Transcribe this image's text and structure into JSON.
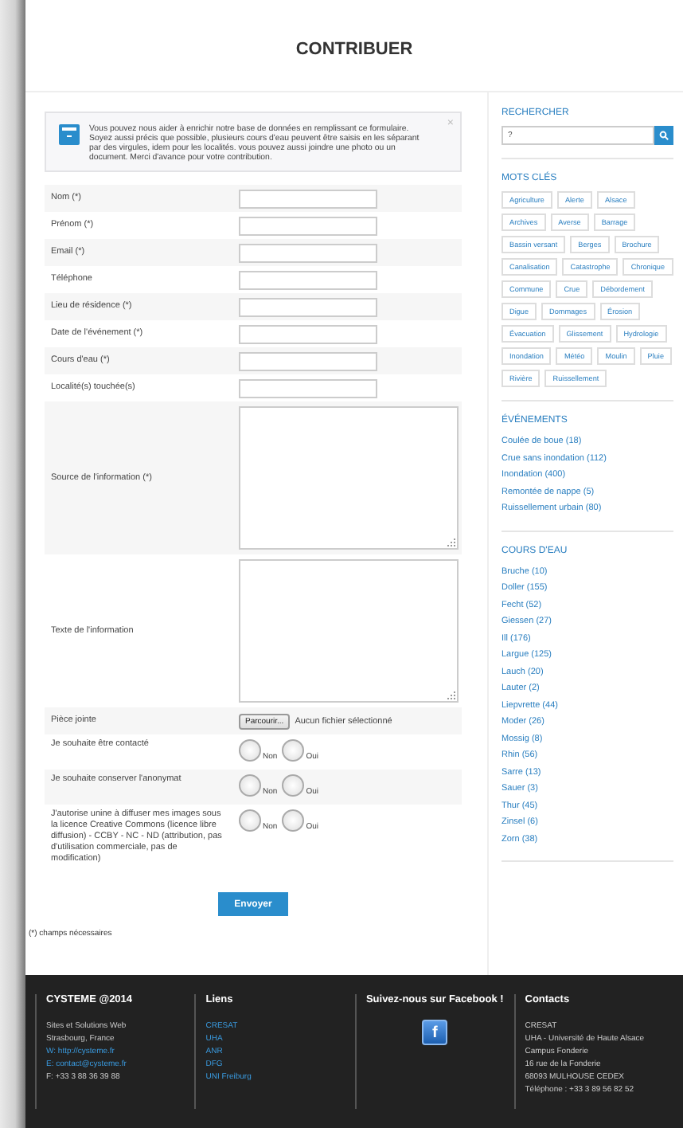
{
  "header": {
    "title": "CONTRIBUER"
  },
  "intro": {
    "text": "Vous pouvez nous aider à enrichir notre base de données en remplissant ce formulaire. Soyez aussi précis que possible, plusieurs cours d'eau peuvent être saisis en les séparant par des virgules, idem pour les localités. vous pouvez aussi joindre une photo ou un document. Merci d'avance pour votre contribution.",
    "close": "×"
  },
  "form": {
    "fields": [
      {
        "kind": "input",
        "label": "Nom (*)"
      },
      {
        "kind": "input",
        "label": "Prénom (*)"
      },
      {
        "kind": "input",
        "label": "Email (*)"
      },
      {
        "kind": "input",
        "label": "Téléphone"
      },
      {
        "kind": "input",
        "label": "Lieu de résidence (*)"
      },
      {
        "kind": "input",
        "label": "Date de l'événement (*)"
      },
      {
        "kind": "input",
        "label": "Cours d'eau (*)"
      },
      {
        "kind": "input",
        "label": "Localité(s) touchée(s)"
      },
      {
        "kind": "textarea",
        "label": "Source de l'information (*)"
      },
      {
        "kind": "textarea",
        "label": "Texte de l'information"
      },
      {
        "kind": "file",
        "label": "Pièce jointe",
        "button": "Parcourir...",
        "status": "Aucun fichier sélectionné"
      },
      {
        "kind": "radio",
        "label": "Je souhaite être contacté",
        "options": [
          {
            "label": "Non",
            "selected": false
          },
          {
            "label": "Oui",
            "selected": false
          }
        ]
      },
      {
        "kind": "radio",
        "label": "Je souhaite conserver l'anonymat",
        "options": [
          {
            "label": "Non",
            "selected": false
          },
          {
            "label": "Oui",
            "selected": false
          }
        ]
      },
      {
        "kind": "radio",
        "label": "J'autorise unine à diffuser mes images sous la licence Creative Commons (licence libre diffusion) - CCBY - NC - ND (attribution, pas d'utilisation commerciale, pas de modification)",
        "options": [
          {
            "label": "Non",
            "selected": false
          },
          {
            "label": "Oui",
            "selected": false
          }
        ]
      }
    ],
    "submit": "Envoyer",
    "note": "(*) champs nécessaires"
  },
  "sidebar": {
    "search": {
      "title": "RECHERCHER",
      "value": "?"
    },
    "tags": {
      "title": "MOTS CLÉS",
      "items": [
        "Agriculture",
        "Alerte",
        "Alsace",
        "Archives",
        "Averse",
        "Barrage",
        "Bassin versant",
        "Berges",
        "Brochure",
        "Canalisation",
        "Catastrophe",
        "Chronique",
        "Commune",
        "Crue",
        "Débordement",
        "Digue",
        "Dommages",
        "Érosion",
        "Évacuation",
        "Glissement",
        "Hydrologie",
        "Inondation",
        "Météo",
        "Moulin",
        "Pluie",
        "Rivière",
        "Ruissellement"
      ]
    },
    "events": {
      "title": "ÉVÉNEMENTS",
      "items": [
        "Coulée de boue (18)",
        "Crue sans inondation (112)",
        "Inondation (400)",
        "Remontée de nappe (5)",
        "Ruissellement urbain (80)"
      ]
    },
    "rivers": {
      "title": "COURS D'EAU",
      "items": [
        "Bruche (10)",
        "Doller (155)",
        "Fecht (52)",
        "Giessen (27)",
        "Ill (176)",
        "Largue (125)",
        "Lauch (20)",
        "Lauter (2)",
        "Liepvrette (44)",
        "Moder (26)",
        "Mossig (8)",
        "Rhin (56)",
        "Sarre (13)",
        "Sauer (3)",
        "Thur (45)",
        "Zinsel (6)",
        "Zorn (38)"
      ]
    }
  },
  "footer": {
    "columns": [
      {
        "kind": "text",
        "title": "CYSTEME @2014",
        "lines": [
          {
            "text": "Sites et Solutions Web",
            "link": false
          },
          {
            "text": "Strasbourg, France",
            "link": false
          },
          {
            "text": "W: http://cysteme.fr",
            "link": true
          },
          {
            "text": "E: contact@cysteme.fr",
            "link": true
          },
          {
            "text": "F: +33 3 88 36 39 88",
            "link": false
          }
        ]
      },
      {
        "kind": "text",
        "title": "Liens",
        "lines": [
          {
            "text": "CRESAT",
            "link": true
          },
          {
            "text": "UHA",
            "link": true
          },
          {
            "text": "ANR",
            "link": true
          },
          {
            "text": "DFG",
            "link": true
          },
          {
            "text": "UNI Freiburg",
            "link": true
          }
        ]
      },
      {
        "kind": "social",
        "title": "Suivez-nous sur Facebook !",
        "icon": "f"
      },
      {
        "kind": "text",
        "title": "Contacts",
        "lines": [
          {
            "text": "CRESAT",
            "link": false
          },
          {
            "text": "UHA - Université de Haute Alsace",
            "link": false
          },
          {
            "text": "Campus Fonderie",
            "link": false
          },
          {
            "text": "16 rue de la Fonderie",
            "link": false
          },
          {
            "text": "68093 MULHOUSE CEDEX",
            "link": false
          },
          {
            "text": "Téléphone : +33 3 89 56 82 52",
            "link": false
          }
        ]
      }
    ]
  }
}
